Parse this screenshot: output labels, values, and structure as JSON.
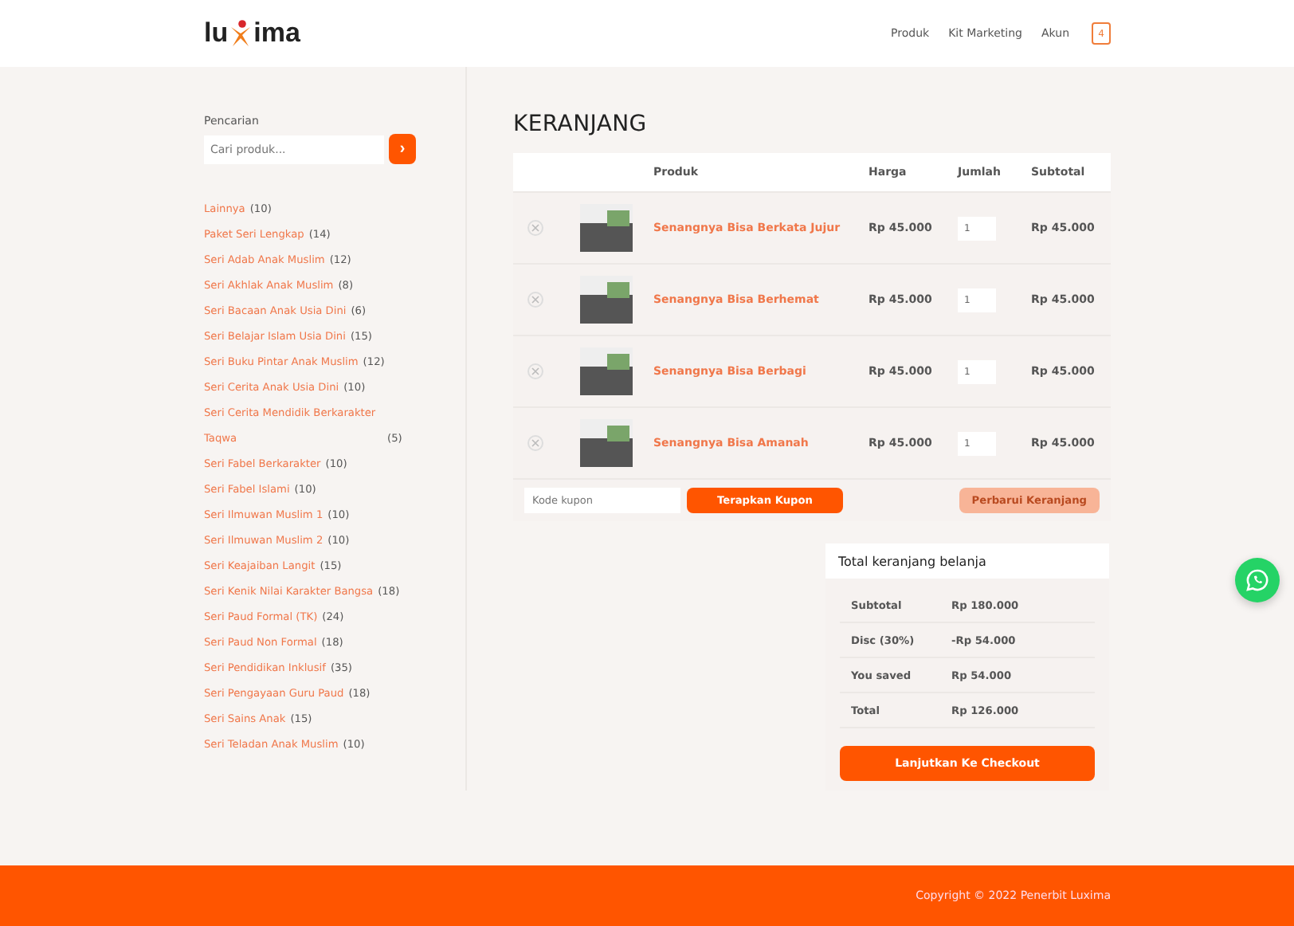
{
  "header": {
    "logo_left": "lu",
    "logo_right": "ima",
    "nav": [
      "Produk",
      "Kit Marketing",
      "Akun"
    ],
    "cart_count": "4"
  },
  "sidebar": {
    "search_label": "Pencarian",
    "search": {
      "placeholder": "Cari produk..."
    },
    "search_button": "›",
    "categories": [
      {
        "name": "Lainnya",
        "count": "(10)"
      },
      {
        "name": "Paket Seri Lengkap",
        "count": "(14)"
      },
      {
        "name": "Seri Adab Anak Muslim",
        "count": "(12)"
      },
      {
        "name": "Seri Akhlak Anak Muslim",
        "count": "(8)"
      },
      {
        "name": "Seri Bacaan Anak Usia Dini",
        "count": "(6)"
      },
      {
        "name": "Seri Belajar Islam Usia Dini",
        "count": "(15)"
      },
      {
        "name": "Seri Buku Pintar Anak Muslim",
        "count": "(12)"
      },
      {
        "name": "Seri Cerita Anak Usia Dini",
        "count": "(10)"
      },
      {
        "name": "Seri Cerita Mendidik Berkarakter Taqwa",
        "count": "(5)"
      },
      {
        "name": "Seri Fabel Berkarakter",
        "count": "(10)"
      },
      {
        "name": "Seri Fabel Islami",
        "count": "(10)"
      },
      {
        "name": "Seri Ilmuwan Muslim 1",
        "count": "(10)"
      },
      {
        "name": "Seri Ilmuwan Muslim 2",
        "count": "(10)"
      },
      {
        "name": "Seri Keajaiban Langit",
        "count": "(15)"
      },
      {
        "name": "Seri Kenik Nilai Karakter Bangsa",
        "count": "(18)"
      },
      {
        "name": "Seri Paud Formal (TK)",
        "count": "(24)"
      },
      {
        "name": "Seri Paud Non Formal",
        "count": "(18)"
      },
      {
        "name": "Seri Pendidikan Inklusif",
        "count": "(35)"
      },
      {
        "name": "Seri Pengayaan Guru Paud",
        "count": "(18)"
      },
      {
        "name": "Seri Sains Anak",
        "count": "(15)"
      },
      {
        "name": "Seri Teladan Anak Muslim",
        "count": "(10)"
      }
    ]
  },
  "cart": {
    "title": "KERANJANG",
    "columns": [
      "Produk",
      "Harga",
      "Jumlah",
      "Subtotal"
    ],
    "rows": [
      {
        "product": "Senangnya Bisa Berkata Jujur",
        "price": "Rp 45.000",
        "quantity": "1",
        "subtotal": "Rp 45.000"
      },
      {
        "product": "Senangnya Bisa Berhemat",
        "price": "Rp 45.000",
        "quantity": "1",
        "subtotal": "Rp 45.000"
      },
      {
        "product": "Senangnya Bisa Berbagi",
        "price": "Rp 45.000",
        "quantity": "1",
        "subtotal": "Rp 45.000"
      },
      {
        "product": "Senangnya Bisa Amanah",
        "price": "Rp 45.000",
        "quantity": "1",
        "subtotal": "Rp 45.000"
      }
    ],
    "coupon": {
      "placeholder": "Kode kupon"
    },
    "apply_button": "Terapkan Kupon",
    "update_button": {
      "label": "Perbarui Keranjang",
      "disabled": true
    }
  },
  "totals": {
    "title": "Total keranjang belanja",
    "rows": [
      {
        "label": "Subtotal",
        "value": "Rp 180.000"
      },
      {
        "label": "Disc (30%)",
        "value": "-Rp 54.000"
      },
      {
        "label": "You saved",
        "value": "Rp 54.000"
      },
      {
        "label": "Total",
        "value": "Rp 126.000"
      }
    ],
    "checkout_button": "Lanjutkan Ke Checkout"
  },
  "footer": {
    "copyright": "Copyright © 2022 Penerbit Luxima"
  }
}
